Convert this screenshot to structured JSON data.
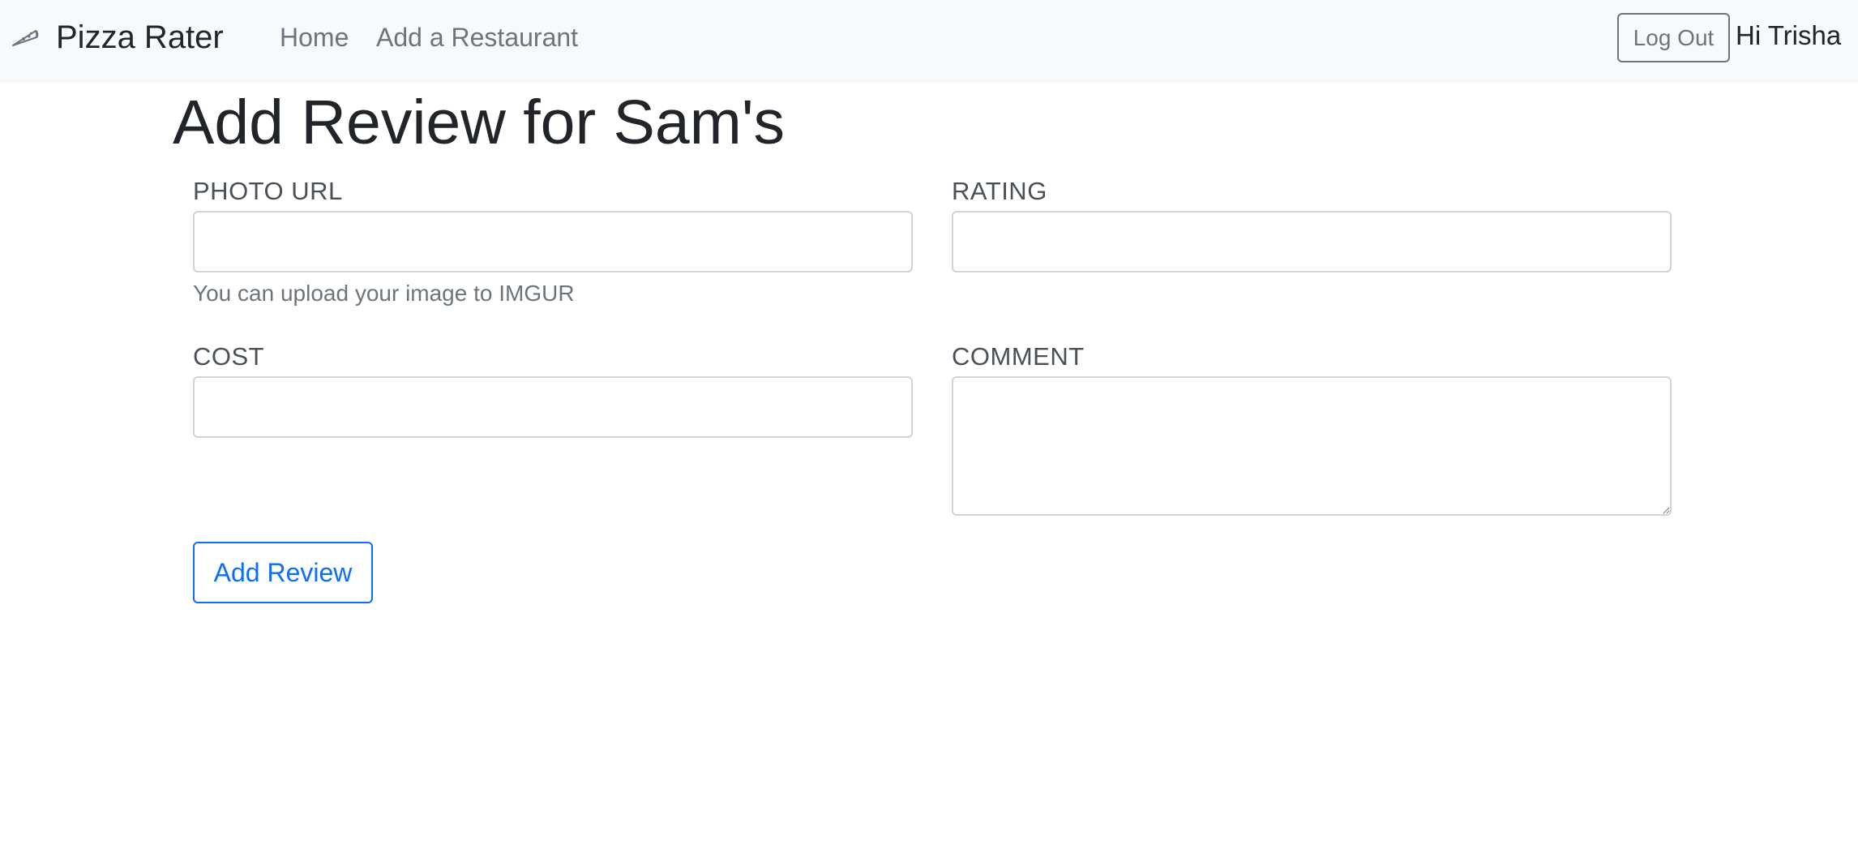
{
  "navbar": {
    "brand_icon": "pizza-slice-icon",
    "brand": "Pizza Rater",
    "links": [
      "Home",
      "Add a Restaurant"
    ],
    "logout_label": "Log Out",
    "greeting": "Hi Trisha"
  },
  "page": {
    "title": "Add Review for Sam's"
  },
  "form": {
    "photo_url": {
      "label": "PHOTO URL",
      "value": "",
      "help": "You can upload your image to IMGUR"
    },
    "rating": {
      "label": "RATING",
      "value": ""
    },
    "cost": {
      "label": "COST",
      "value": ""
    },
    "comment": {
      "label": "COMMENT",
      "value": ""
    },
    "submit_label": "Add Review"
  },
  "colors": {
    "navbar_bg": "#f8f9fa",
    "primary": "#0d6efd",
    "secondary": "#6c757d",
    "text": "#212529",
    "input_border": "#ced4da"
  }
}
